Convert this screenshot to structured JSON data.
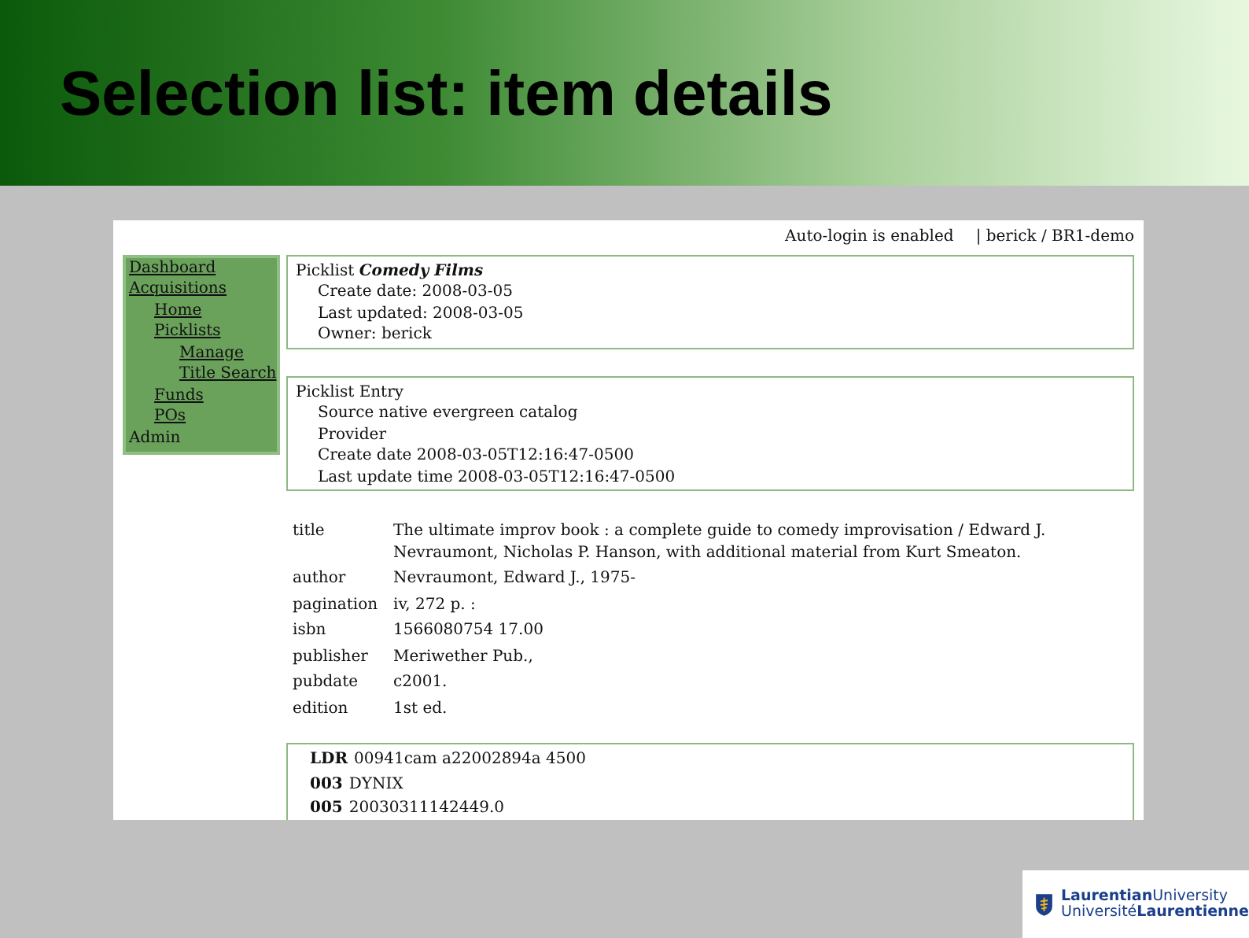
{
  "slide_title": "Selection list: item details",
  "screenshot": {
    "header": {
      "login_status": "Auto-login is enabled",
      "user": "| berick / BR1-demo"
    },
    "sidebar": {
      "items": [
        {
          "label": "Dashboard",
          "kind": "link"
        },
        {
          "label": "Acquisitions",
          "kind": "link",
          "children": [
            {
              "label": "Home",
              "kind": "link"
            },
            {
              "label": "Picklists",
              "kind": "link",
              "children": [
                {
                  "label": "Manage",
                  "kind": "link"
                },
                {
                  "label": "Title Search",
                  "kind": "link"
                }
              ]
            },
            {
              "label": "Funds",
              "kind": "link"
            },
            {
              "label": "POs",
              "kind": "link"
            }
          ]
        },
        {
          "label": "Admin",
          "kind": "text"
        }
      ]
    },
    "picklist": {
      "heading": "Picklist **Comedy Films**",
      "lines": [
        "Create date: 2008-03-05",
        "Last updated: 2008-03-05",
        "Owner: berick"
      ]
    },
    "entry": {
      "heading": "Picklist Entry",
      "lines": [
        "Source native evergreen catalog",
        "Provider",
        "Create date 2008-03-05T12:16:47-0500",
        "Last update time 2008-03-05T12:16:47-0500"
      ]
    },
    "fields": [
      {
        "key": "title",
        "value": "The ultimate improv book : a complete guide to comedy improvisation / Edward J. Nevraumont, Nicholas P. Hanson, with additional material from Kurt Smeaton."
      },
      {
        "key": "author",
        "value": "Nevraumont, Edward J., 1975-"
      },
      {
        "key": "pagination",
        "value": "iv, 272 p. :"
      },
      {
        "key": "isbn",
        "value": "1566080754 17.00"
      },
      {
        "key": "publisher",
        "value": "Meriwether Pub.,"
      },
      {
        "key": "pubdate",
        "value": "c2001."
      },
      {
        "key": "edition",
        "value": "1st ed."
      }
    ],
    "marc": [
      {
        "tag": "LDR",
        "value": "00941cam a22002894a 4500"
      },
      {
        "tag": "003",
        "value": "DYNIX"
      },
      {
        "tag": "005",
        "value": "20030311142449.0"
      }
    ]
  },
  "logo": {
    "line_1": "**Laurentian**University",
    "line_2": "Université**Laurentienne**"
  }
}
